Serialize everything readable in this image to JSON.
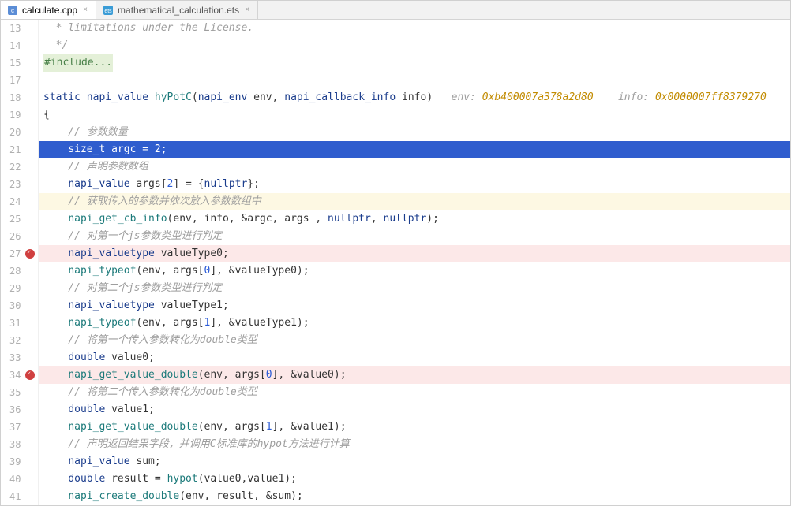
{
  "tabs": [
    {
      "label": "calculate.cpp",
      "active": true
    },
    {
      "label": "mathematical_calculation.ets",
      "active": false
    }
  ],
  "firstLineNumber": 13,
  "lines": [
    {
      "cls": "",
      "tokens": [
        [
          "  * limitations under the License.",
          "cm-comment"
        ]
      ],
      "indent": 1
    },
    {
      "cls": "",
      "tokens": [
        [
          "  */",
          "cm-comment"
        ]
      ],
      "indent": 1,
      "foldEnd": true
    },
    {
      "cls": "",
      "tokens": [
        [
          "#include...",
          "include-hl"
        ]
      ],
      "indent": 0,
      "foldClosed": true
    },
    {
      "cls": "",
      "tokens": [
        [
          "",
          ""
        ]
      ],
      "indent": 0
    },
    {
      "cls": "",
      "tokens": [
        [
          "static ",
          "cm-keyword"
        ],
        [
          "napi_value ",
          "cm-type"
        ],
        [
          "hyPotC",
          "cm-func"
        ],
        [
          "(",
          "cm-op"
        ],
        [
          "napi_env ",
          "cm-type"
        ],
        [
          "env, ",
          "cm-ident"
        ],
        [
          "napi_callback_info ",
          "cm-type"
        ],
        [
          "info",
          "cm-ident"
        ],
        [
          ")",
          "cm-op"
        ],
        [
          "   ",
          ""
        ],
        [
          "env: ",
          "cm-hint"
        ],
        [
          "0xb400007a378a2d80",
          "cm-hintval"
        ],
        [
          "    ",
          ""
        ],
        [
          "info: ",
          "cm-hint"
        ],
        [
          "0x0000007ff8379270",
          "cm-hintval"
        ]
      ],
      "indent": 0
    },
    {
      "cls": "",
      "tokens": [
        [
          "{",
          "cm-op"
        ]
      ],
      "indent": 0,
      "foldOpen": true
    },
    {
      "cls": "",
      "tokens": [
        [
          "    // 参数数量",
          "cm-comment"
        ]
      ],
      "indent": 0
    },
    {
      "cls": "selected",
      "tokens": [
        [
          "    size_t argc = 2;",
          "sel"
        ]
      ],
      "indent": 0
    },
    {
      "cls": "",
      "tokens": [
        [
          "    // 声明参数数组",
          "cm-comment"
        ]
      ],
      "indent": 0
    },
    {
      "cls": "",
      "tokens": [
        [
          "    ",
          ""
        ],
        [
          "napi_value ",
          "cm-type"
        ],
        [
          "args[",
          "cm-ident"
        ],
        [
          "2",
          "cm-num"
        ],
        [
          "] = {",
          "cm-op"
        ],
        [
          "nullptr",
          "cm-null"
        ],
        [
          "};",
          "cm-op"
        ]
      ],
      "indent": 0
    },
    {
      "cls": "yellow-hl",
      "tokens": [
        [
          "    // 获取传入的参数并依次放入参数数组中",
          "cm-comment"
        ]
      ],
      "indent": 0,
      "cursor": true
    },
    {
      "cls": "",
      "tokens": [
        [
          "    ",
          ""
        ],
        [
          "napi_get_cb_info",
          "cm-func"
        ],
        [
          "(env, info, &argc, args , ",
          "cm-ident"
        ],
        [
          "nullptr",
          "cm-null"
        ],
        [
          ", ",
          "cm-op"
        ],
        [
          "nullptr",
          "cm-null"
        ],
        [
          ");",
          "cm-op"
        ]
      ],
      "indent": 0
    },
    {
      "cls": "",
      "tokens": [
        [
          "    // 对第一个js参数类型进行判定",
          "cm-comment"
        ]
      ],
      "indent": 0
    },
    {
      "cls": "pink-hl",
      "tokens": [
        [
          "    ",
          ""
        ],
        [
          "napi_valuetype ",
          "cm-type"
        ],
        [
          "valueType0;",
          "cm-ident"
        ]
      ],
      "indent": 0,
      "bp": true
    },
    {
      "cls": "",
      "tokens": [
        [
          "    ",
          ""
        ],
        [
          "napi_typeof",
          "cm-func"
        ],
        [
          "(env, args[",
          "cm-ident"
        ],
        [
          "0",
          "cm-num"
        ],
        [
          "], &valueType0);",
          "cm-ident"
        ]
      ],
      "indent": 0
    },
    {
      "cls": "",
      "tokens": [
        [
          "    // 对第二个js参数类型进行判定",
          "cm-comment"
        ]
      ],
      "indent": 0
    },
    {
      "cls": "",
      "tokens": [
        [
          "    ",
          ""
        ],
        [
          "napi_valuetype ",
          "cm-type"
        ],
        [
          "valueType1;",
          "cm-ident"
        ]
      ],
      "indent": 0
    },
    {
      "cls": "",
      "tokens": [
        [
          "    ",
          ""
        ],
        [
          "napi_typeof",
          "cm-func"
        ],
        [
          "(env, args[",
          "cm-ident"
        ],
        [
          "1",
          "cm-num"
        ],
        [
          "], &valueType1);",
          "cm-ident"
        ]
      ],
      "indent": 0
    },
    {
      "cls": "",
      "tokens": [
        [
          "    // 将第一个传入参数转化为double类型",
          "cm-comment"
        ]
      ],
      "indent": 0
    },
    {
      "cls": "",
      "tokens": [
        [
          "    ",
          ""
        ],
        [
          "double ",
          "cm-keyword"
        ],
        [
          "value0;",
          "cm-ident"
        ]
      ],
      "indent": 0
    },
    {
      "cls": "pink-hl",
      "tokens": [
        [
          "    ",
          ""
        ],
        [
          "napi_get_value_double",
          "cm-func"
        ],
        [
          "(env, args[",
          "cm-ident"
        ],
        [
          "0",
          "cm-num"
        ],
        [
          "], &value0);",
          "cm-ident"
        ]
      ],
      "indent": 0,
      "bp": true
    },
    {
      "cls": "",
      "tokens": [
        [
          "    // 将第二个传入参数转化为double类型",
          "cm-comment"
        ]
      ],
      "indent": 0
    },
    {
      "cls": "",
      "tokens": [
        [
          "    ",
          ""
        ],
        [
          "double ",
          "cm-keyword"
        ],
        [
          "value1;",
          "cm-ident"
        ]
      ],
      "indent": 0
    },
    {
      "cls": "",
      "tokens": [
        [
          "    ",
          ""
        ],
        [
          "napi_get_value_double",
          "cm-func"
        ],
        [
          "(env, args[",
          "cm-ident"
        ],
        [
          "1",
          "cm-num"
        ],
        [
          "], &value1);",
          "cm-ident"
        ]
      ],
      "indent": 0
    },
    {
      "cls": "",
      "tokens": [
        [
          "    // 声明返回结果字段，并调用C标准库的hypot方法进行计算",
          "cm-comment"
        ]
      ],
      "indent": 0
    },
    {
      "cls": "",
      "tokens": [
        [
          "    ",
          ""
        ],
        [
          "napi_value ",
          "cm-type"
        ],
        [
          "sum;",
          "cm-ident"
        ]
      ],
      "indent": 0
    },
    {
      "cls": "",
      "tokens": [
        [
          "    ",
          ""
        ],
        [
          "double ",
          "cm-keyword"
        ],
        [
          "result = ",
          "cm-ident"
        ],
        [
          "hypot",
          "cm-func"
        ],
        [
          "(value0,value1);",
          "cm-ident"
        ]
      ],
      "indent": 0
    },
    {
      "cls": "",
      "tokens": [
        [
          "    ",
          ""
        ],
        [
          "napi_create_double",
          "cm-func"
        ],
        [
          "(env, result, &sum);",
          "cm-ident"
        ]
      ],
      "indent": 0
    }
  ]
}
